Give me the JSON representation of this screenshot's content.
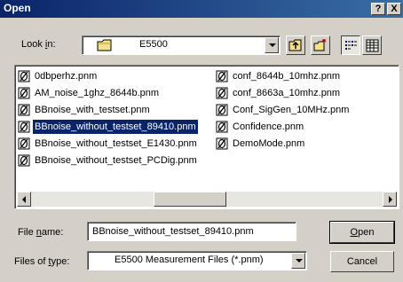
{
  "dialog": {
    "title": "Open",
    "help_label": "?",
    "close_label": "X"
  },
  "lookin": {
    "label_pre": "Look ",
    "label_hot": "i",
    "label_post": "n:",
    "value": "E5500",
    "folder_icon": "folder-icon"
  },
  "toolbar": {
    "up_icon": "up-folder-icon",
    "new_icon": "new-folder-icon",
    "list_icon": "list-view-icon",
    "details_icon": "details-view-icon"
  },
  "files": {
    "col1": [
      "0dbperhz.pnm",
      "AM_noise_1ghz_8644b.pnm",
      "BBnoise_with_testset.pnm",
      "BBnoise_without_testset_89410.pnm",
      "BBnoise_without_testset_E1430.pnm",
      "BBnoise_without_testset_PCDig.pnm"
    ],
    "col2": [
      "conf_8644b_10mhz.pnm",
      "conf_8663a_10mhz.pnm",
      "Conf_SigGen_10MHz.pnm",
      "Confidence.pnm",
      "DemoMode.pnm"
    ],
    "selected": "BBnoise_without_testset_89410.pnm"
  },
  "filename": {
    "label_pre": "File ",
    "label_hot": "n",
    "label_post": "ame:",
    "value": "BBnoise_without_testset_89410.pnm"
  },
  "filetype": {
    "label_pre": "Files of ",
    "label_hot": "t",
    "label_post": "ype:",
    "value": "E5500 Measurement Files (*.pnm)"
  },
  "buttons": {
    "open_hot": "O",
    "open_rest": "pen",
    "cancel": "Cancel"
  }
}
